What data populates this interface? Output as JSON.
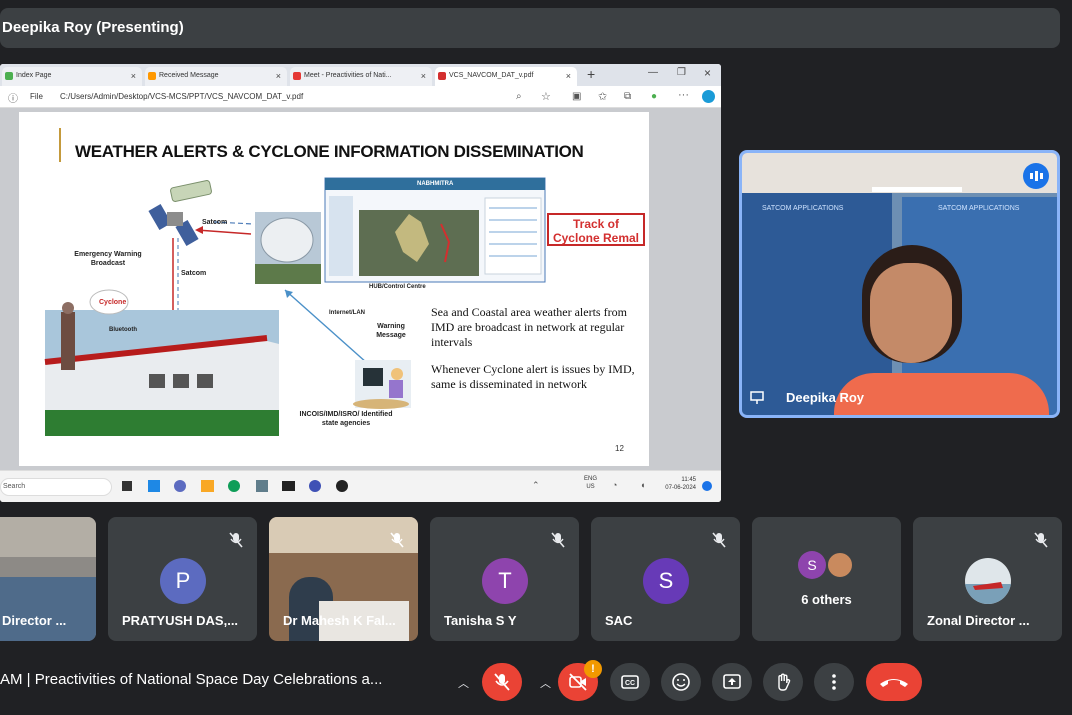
{
  "presenter_bar": {
    "title": "Deepika Roy (Presenting)"
  },
  "browser": {
    "tabs": [
      {
        "label": "Index Page",
        "fav": "#4caf50"
      },
      {
        "label": "Received Message",
        "fav": "#ff9800"
      },
      {
        "label": "Meet - Preactivities of Nati...",
        "fav": "#e53935"
      },
      {
        "label": "VCS_NAVCOM_DAT_v.pdf",
        "fav": "#d32f2f"
      }
    ],
    "file_label": "File",
    "url": "C:/Users/Admin/Desktop/VCS-MCS/PPT/VCS_NAVCOM_DAT_v.pdf",
    "new_tab": "+"
  },
  "slide": {
    "title": "WEATHER ALERTS & CYCLONE INFORMATION DISSEMINATION",
    "labels": {
      "emergency": "Emergency Warning Broadcast",
      "satcom1": "Satcom",
      "satcom2": "Satcom",
      "cyclone": "Cyclone",
      "bluetooth": "Bluetooth",
      "hub": "HUB/Control Centre",
      "internet": "Internet/LAN",
      "warning": "Warning Message",
      "incois": "INCOIS/IMD/ISRO/ Identified state agencies",
      "navtex": "NABHMITRA"
    },
    "track_box": "Track of Cyclone Remal",
    "para1": "Sea and Coastal area weather alerts from IMD are broadcast in network at regular intervals",
    "para2": "Whenever Cyclone alert is issues by IMD, same is disseminated in network",
    "page_number": "12"
  },
  "taskbar": {
    "search": "Search",
    "lang1": "ENG",
    "lang2": "US",
    "time": "11:45",
    "date": "07-06-2024"
  },
  "presenter_tile": {
    "name": "Deepika Roy",
    "banner": "SATCOM APPLICATIONS"
  },
  "participants": [
    {
      "name": "Director ...",
      "type": "video"
    },
    {
      "name": "PRATYUSH DAS,...",
      "initial": "P",
      "color": "#5c6bc0"
    },
    {
      "name": "Dr Mahesh K Fal...",
      "type": "video"
    },
    {
      "name": "Tanisha S Y",
      "initial": "T",
      "color": "#8e44ad"
    },
    {
      "name": "SAC",
      "initial": "S",
      "color": "#673ab7"
    },
    {
      "name": "6 others",
      "initial": "S",
      "color": "#8e44ad"
    },
    {
      "name": "Zonal Director ...",
      "type": "avatar"
    }
  ],
  "bottom": {
    "meeting": "AM  |  Preactivities of National Space Day Celebrations a...",
    "camera_badge": "!"
  },
  "colors": {
    "bg": "#202124",
    "tile": "#3c4043",
    "end_call": "#ea4335",
    "accent": "#8ab4f8"
  }
}
